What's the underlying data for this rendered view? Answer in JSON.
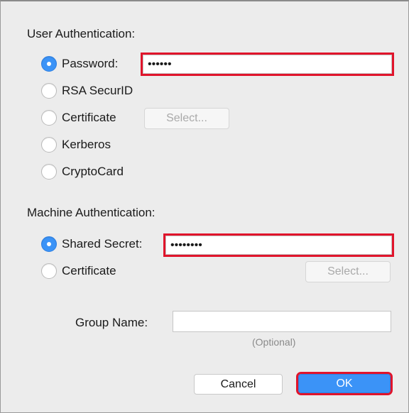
{
  "user_auth": {
    "title": "User Authentication:",
    "options": [
      {
        "label": "Password:",
        "checked": true
      },
      {
        "label": "RSA SecurID",
        "checked": false
      },
      {
        "label": "Certificate",
        "checked": false
      },
      {
        "label": "Kerberos",
        "checked": false
      },
      {
        "label": "CryptoCard",
        "checked": false
      }
    ],
    "password_value": "••••••",
    "select_label": "Select..."
  },
  "machine_auth": {
    "title": "Machine Authentication:",
    "options": [
      {
        "label": "Shared Secret:",
        "checked": true
      },
      {
        "label": "Certificate",
        "checked": false
      }
    ],
    "shared_secret_value": "••••••••",
    "select_label": "Select..."
  },
  "group": {
    "label": "Group Name:",
    "value": "",
    "note": "(Optional)"
  },
  "buttons": {
    "cancel": "Cancel",
    "ok": "OK"
  },
  "colors": {
    "accent": "#3b93f7",
    "highlight": "#e0142b"
  }
}
